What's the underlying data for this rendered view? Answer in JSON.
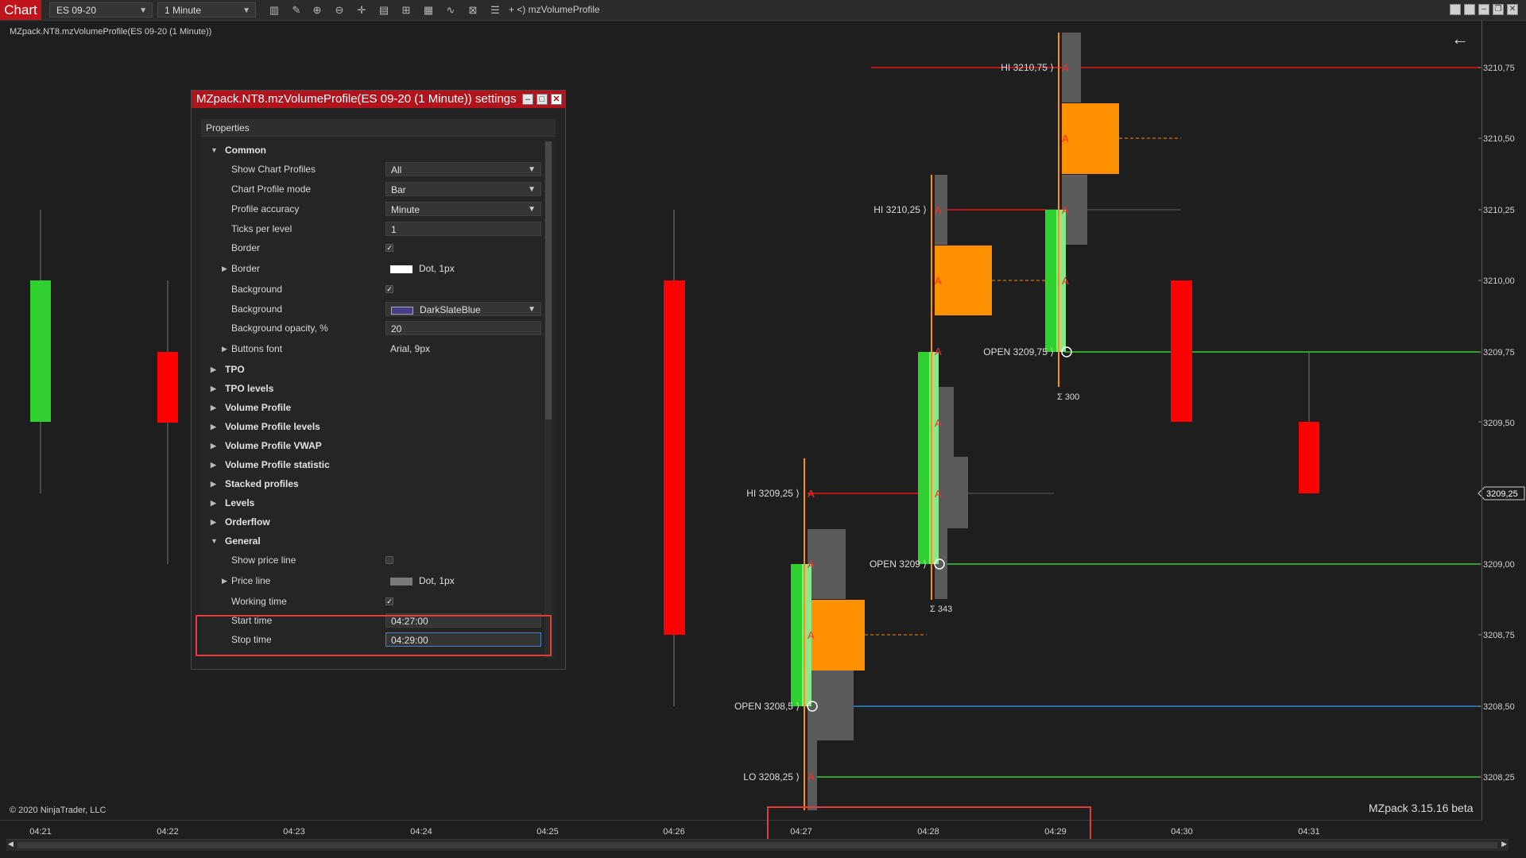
{
  "toolbar": {
    "tab_label": "Chart",
    "instrument": "ES 09-20",
    "interval": "1 Minute",
    "indicator_label": "+ <) mzVolumeProfile",
    "icons": [
      "bar-type-icon",
      "draw-tool-icon",
      "zoom-in-icon",
      "zoom-out-icon",
      "crosshair-icon",
      "data-box-icon",
      "strategy-icon",
      "chart-trader-icon",
      "indicator-icon",
      "properties-icon",
      "list-icon"
    ]
  },
  "chart": {
    "title": "MZpack.NT8.mzVolumeProfile(ES 09-20 (1 Minute))",
    "copyright": "© 2020 NinjaTrader, LLC",
    "version": "MZpack 3.15.16 beta",
    "time_labels": [
      "04:21",
      "04:22",
      "04:23",
      "04:24",
      "04:25",
      "04:26",
      "04:27",
      "04:28",
      "04:29",
      "04:30",
      "04:31"
    ],
    "price_labels": [
      "3210,75",
      "3210,50",
      "3210,25",
      "3210,00",
      "3209,75",
      "3209,50",
      "3209,25",
      "3209,00",
      "3208,75",
      "3208,50",
      "3208,25"
    ],
    "current_price": "3209,25",
    "annotations": {
      "hi_1": "HI 3209,25 ⟩",
      "open_1": "OPEN 3208,5 ⟩",
      "lo_1": "LO 3208,25 ⟩",
      "hi_2": "HI 3210,25 ⟩",
      "open_2": "OPEN 3209 ⟩",
      "sum_2": "Σ 343",
      "hi_3": "HI 3210,75 ⟩",
      "open_3": "OPEN 3209,75 ⟩",
      "sum_3": "Σ 300",
      "tpo_letter": "A"
    },
    "colors": {
      "up": "#2fd12f",
      "down": "#ff0000",
      "poc": "#ff9000",
      "profile": "#5b5b5b",
      "hi_line": "#e21a1a",
      "open_line_green": "#2fd12f",
      "open_line_blue": "#2f8ad8"
    }
  },
  "dialog": {
    "title": "MZpack.NT8.mzVolumeProfile(ES 09-20 (1 Minute)) settings",
    "panel_header": "Properties",
    "common": {
      "label": "Common",
      "show_chart_profiles": {
        "label": "Show Chart Profiles",
        "value": "All"
      },
      "chart_profile_mode": {
        "label": "Chart Profile mode",
        "value": "Bar"
      },
      "profile_accuracy": {
        "label": "Profile accuracy",
        "value": "Minute"
      },
      "ticks_per_level": {
        "label": "Ticks per level",
        "value": "1"
      },
      "border_check": {
        "label": "Border",
        "checked": true
      },
      "border_style": {
        "label": "Border",
        "value": "Dot, 1px"
      },
      "background_check": {
        "label": "Background",
        "checked": true
      },
      "background_color": {
        "label": "Background",
        "value": "DarkSlateBlue",
        "color": "#483d8b"
      },
      "background_opacity": {
        "label": "Background opacity, %",
        "value": "20"
      },
      "buttons_font": {
        "label": "Buttons font",
        "value": "Arial, 9px"
      }
    },
    "categories": [
      "TPO",
      "TPO levels",
      "Volume Profile",
      "Volume Profile levels",
      "Volume Profile VWAP",
      "Volume Profile statistic",
      "Stacked profiles",
      "Levels",
      "Orderflow"
    ],
    "general": {
      "label": "General",
      "show_price_line": {
        "label": "Show price line",
        "checked": false
      },
      "price_line": {
        "label": "Price line",
        "value": "Dot, 1px"
      },
      "working_time": {
        "label": "Working time",
        "checked": true
      },
      "start_time": {
        "label": "Start time",
        "value": "04:27:00"
      },
      "stop_time": {
        "label": "Stop time",
        "value": "04:29:00"
      }
    }
  }
}
